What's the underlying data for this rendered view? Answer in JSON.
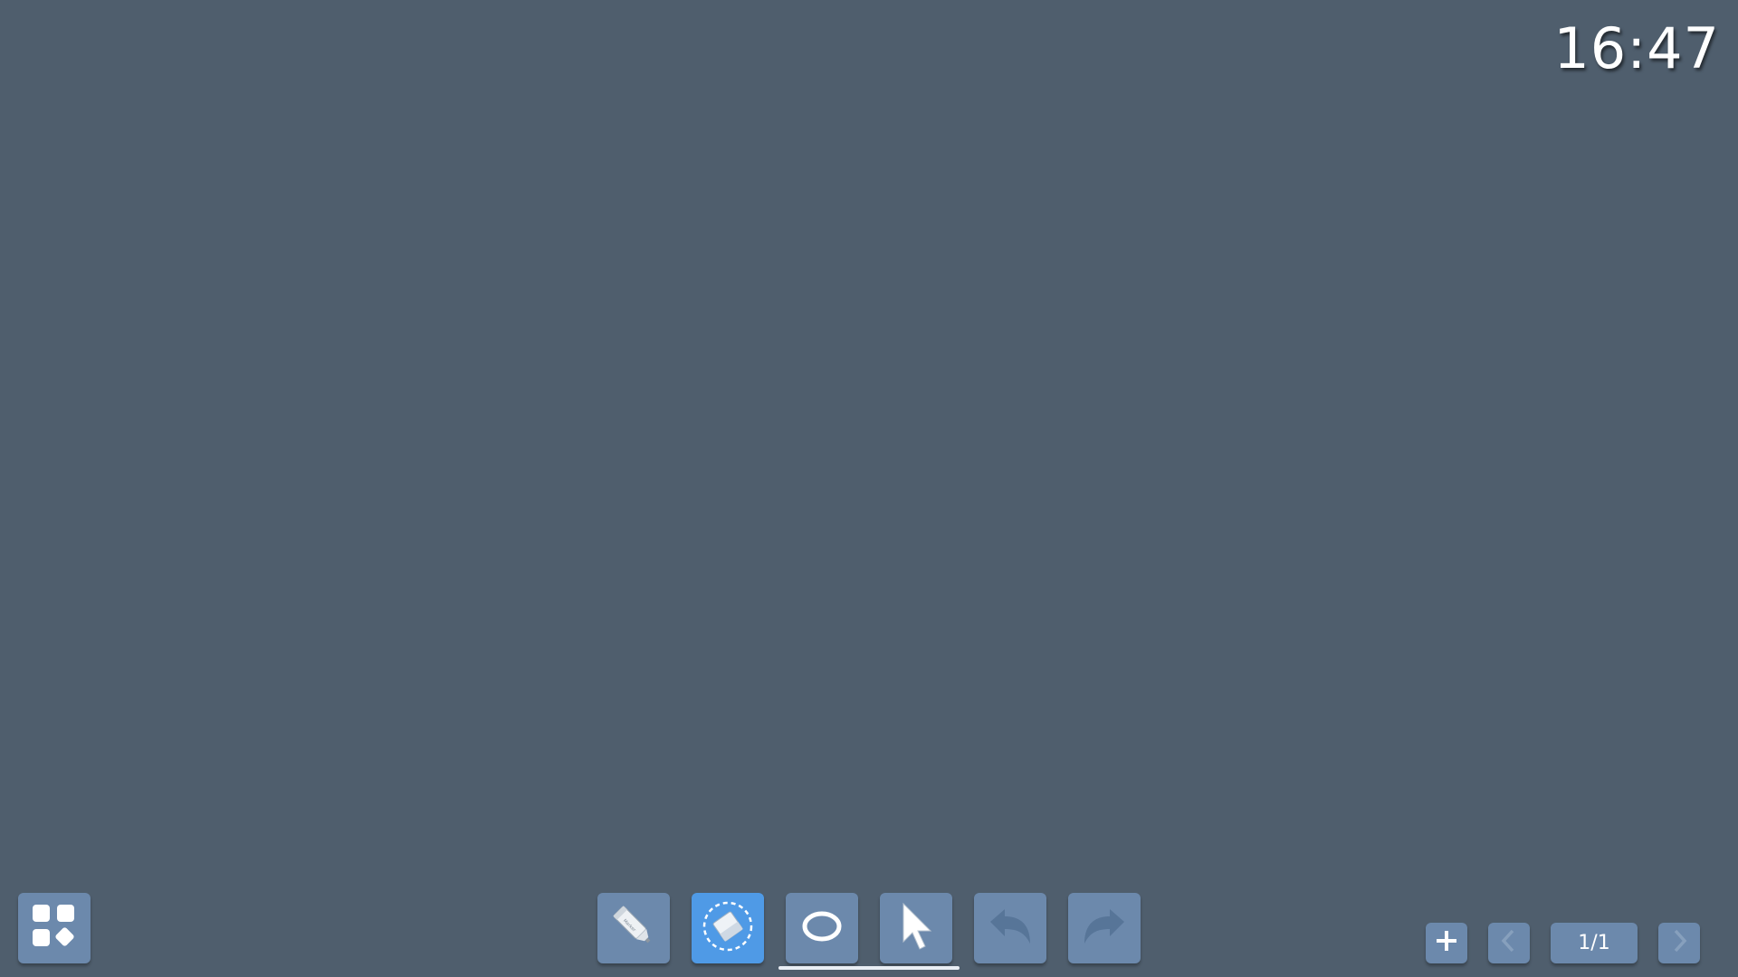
{
  "clock": {
    "time": "16:47"
  },
  "toolbar": {
    "tools": [
      {
        "name": "pen",
        "icon": "marker-pen-icon",
        "active": false
      },
      {
        "name": "eraser",
        "icon": "eraser-icon",
        "active": true
      },
      {
        "name": "shape",
        "icon": "ellipse-icon",
        "active": false
      },
      {
        "name": "select",
        "icon": "cursor-arrow-icon",
        "active": false
      },
      {
        "name": "undo",
        "icon": "undo-icon",
        "active": false,
        "disabled": true
      },
      {
        "name": "redo",
        "icon": "redo-icon",
        "active": false,
        "disabled": true
      }
    ],
    "apps_icon": "apps-grid-icon",
    "active_color": "#4f9ae6",
    "button_color": "#6c89ac"
  },
  "pagination": {
    "indicator": "1/1",
    "add_icon": "plus-icon",
    "prev_icon": "chevron-left-icon",
    "next_icon": "chevron-right-icon"
  },
  "canvas": {
    "background": "#4f5e6d"
  }
}
